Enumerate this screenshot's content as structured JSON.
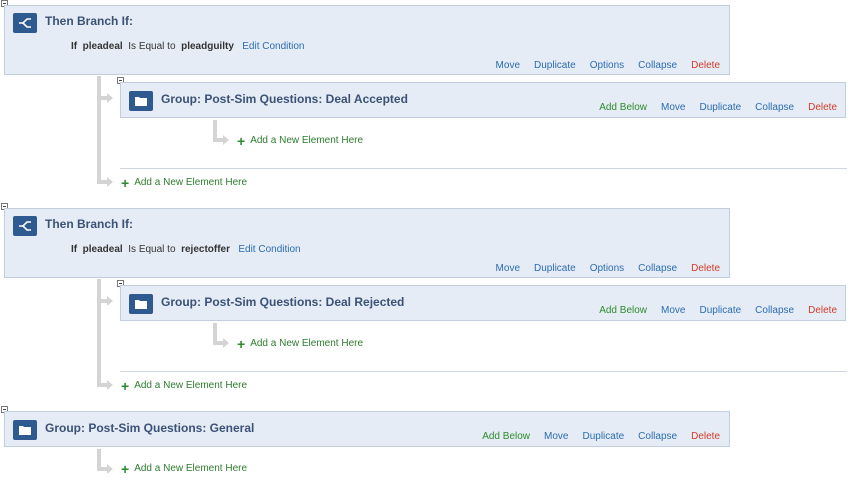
{
  "branch1": {
    "title": "Then Branch If:",
    "cond_if": "If",
    "cond_var": "pleadeal",
    "cond_op": "Is Equal to",
    "cond_val": "pleadguilty",
    "edit": "Edit Condition",
    "actions": [
      "Move",
      "Duplicate",
      "Options",
      "Collapse",
      "Delete"
    ]
  },
  "group1": {
    "title": "Group: Post-Sim Questions: Deal Accepted",
    "actions": [
      "Add Below",
      "Move",
      "Duplicate",
      "Collapse",
      "Delete"
    ],
    "add_inner": "Add a New Element Here",
    "add_outer": "Add a New Element Here"
  },
  "branch2": {
    "title": "Then Branch If:",
    "cond_if": "If",
    "cond_var": "pleadeal",
    "cond_op": "Is Equal to",
    "cond_val": "rejectoffer",
    "edit": "Edit Condition",
    "actions": [
      "Move",
      "Duplicate",
      "Options",
      "Collapse",
      "Delete"
    ]
  },
  "group2": {
    "title": "Group: Post-Sim Questions: Deal Rejected",
    "actions": [
      "Add Below",
      "Move",
      "Duplicate",
      "Collapse",
      "Delete"
    ],
    "add_inner": "Add a New Element Here",
    "add_outer": "Add a New Element Here"
  },
  "group3": {
    "title": "Group: Post-Sim Questions: General",
    "actions": [
      "Add Below",
      "Move",
      "Duplicate",
      "Collapse",
      "Delete"
    ],
    "add_outer": "Add a New Element Here"
  },
  "icons": {
    "branch": "branch-icon",
    "group": "folder-icon",
    "add": "plus-icon",
    "collapse": "collapse-minus-icon"
  },
  "colors": {
    "card_bg": "#e6ecf5",
    "icon_bg": "#2f5a8f",
    "link": "#2b6cb0",
    "green": "#2e8b2e",
    "red": "#d03b2a"
  }
}
